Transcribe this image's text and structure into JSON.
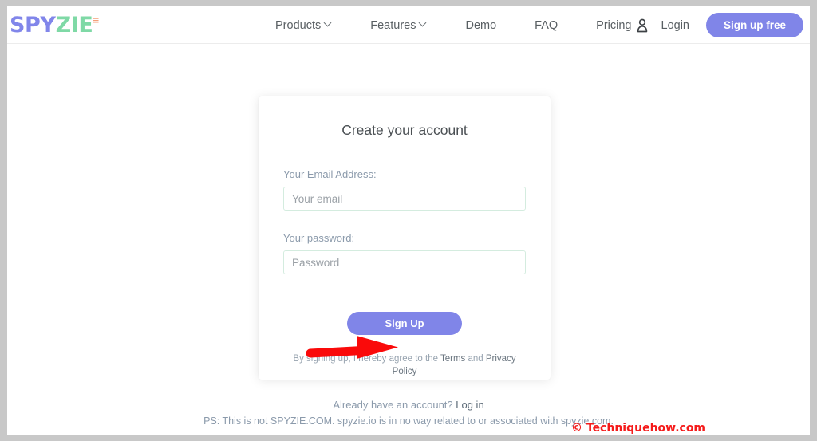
{
  "brand": {
    "logo_part1": "SPY",
    "logo_part2": "ZIE",
    "logo_tm": "≡",
    "colors": {
      "logo_primary": "#8186ea",
      "logo_secondary": "#7fd9a6",
      "logo_mark": "#f5a07a",
      "accent_purple": "#8085e8",
      "input_border": "#d4ecdf",
      "annotation_red": "#f51b1b",
      "muted_text": "#8b9aab"
    }
  },
  "header": {
    "nav": [
      {
        "label": "Products",
        "has_dropdown": true,
        "icon": "chevron-down-icon"
      },
      {
        "label": "Features",
        "has_dropdown": true,
        "icon": "chevron-down-icon"
      },
      {
        "label": "Demo",
        "has_dropdown": false
      },
      {
        "label": "FAQ",
        "has_dropdown": false
      },
      {
        "label": "Pricing",
        "has_dropdown": false
      }
    ],
    "user_icon": "user-icon",
    "login_label": "Login",
    "signup_free_label": "Sign up free"
  },
  "card": {
    "title": "Create your account",
    "email": {
      "label": "Your Email Address:",
      "placeholder": "Your email",
      "value": ""
    },
    "password": {
      "label": "Your password:",
      "placeholder": "Password",
      "value": ""
    },
    "submit_label": "Sign Up",
    "terms": {
      "prefix": "By signing up, I hereby agree to the ",
      "terms_link": "Terms",
      "middle": " and ",
      "privacy_link": "Privacy Policy"
    }
  },
  "footer": {
    "already_account_text": "Already have an account? ",
    "login_link": "Log in",
    "disclaimer": "PS: This is not SPYZIE.COM. spyzie.io is in no way related to or associated with spyzie.com."
  },
  "annotation": {
    "watermark": "© Techniquehow.com",
    "arrow": "red-arrow-pointing-to-sign-up-button"
  }
}
